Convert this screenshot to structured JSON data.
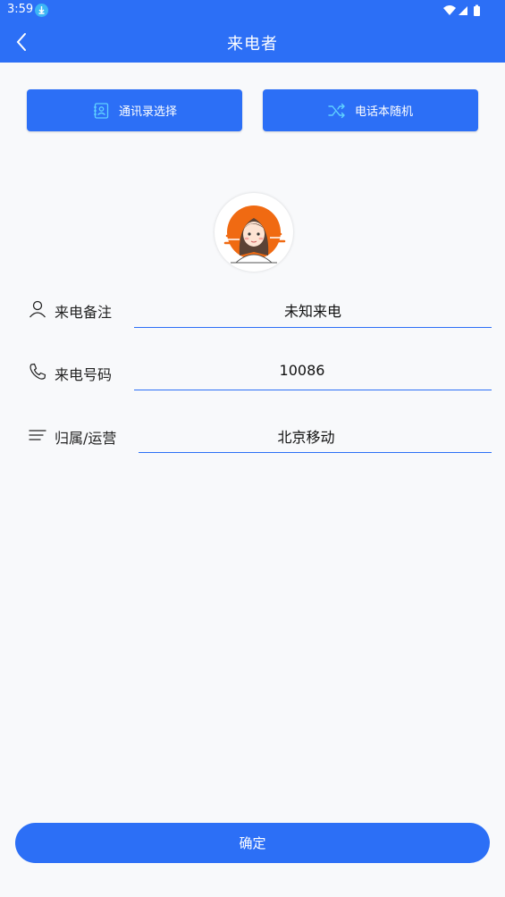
{
  "status_bar": {
    "time": "3:59",
    "download_icon": "download-icon",
    "wifi_icon": "wifi-icon",
    "signal_icon": "signal-icon",
    "battery_icon": "battery-icon"
  },
  "app_bar": {
    "title": "来电者",
    "back_icon": "chevron-left-icon"
  },
  "actions": {
    "contacts_label": "通讯录选择",
    "contacts_icon": "contact-book-icon",
    "random_label": "电话本随机",
    "random_icon": "shuffle-icon"
  },
  "avatar": {
    "icon": "avatar-girl-icon"
  },
  "form": {
    "remark": {
      "label": "来电备注",
      "value": "未知来电",
      "icon": "person-icon"
    },
    "number": {
      "label": "来电号码",
      "value": "10086",
      "icon": "phone-icon"
    },
    "carrier": {
      "label": "归属/运营",
      "value": "北京移动",
      "icon": "menu-lines-icon"
    }
  },
  "confirm_label": "确定",
  "colors": {
    "primary": "#2c6ff6",
    "background": "#f8f9fb",
    "avatar_accent": "#f06a12"
  }
}
